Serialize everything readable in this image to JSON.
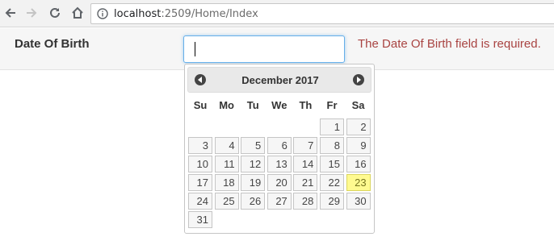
{
  "browser": {
    "url_host": "localhost",
    "url_rest": ":2509/Home/Index"
  },
  "form": {
    "label": "Date Of Birth",
    "input_value": "",
    "validation_message": "The Date Of Birth field is required."
  },
  "datepicker": {
    "month": "December",
    "year": "2017",
    "weekdays": [
      "Su",
      "Mo",
      "Tu",
      "We",
      "Th",
      "Fr",
      "Sa"
    ],
    "first_weekday_index": 5,
    "days": [
      "1",
      "2",
      "3",
      "4",
      "5",
      "6",
      "7",
      "8",
      "9",
      "10",
      "11",
      "12",
      "13",
      "14",
      "15",
      "16",
      "17",
      "18",
      "19",
      "20",
      "21",
      "22",
      "23",
      "24",
      "25",
      "26",
      "27",
      "28",
      "29",
      "30",
      "31"
    ],
    "highlighted_day": "23",
    "highlight_color": "#fffa90"
  }
}
